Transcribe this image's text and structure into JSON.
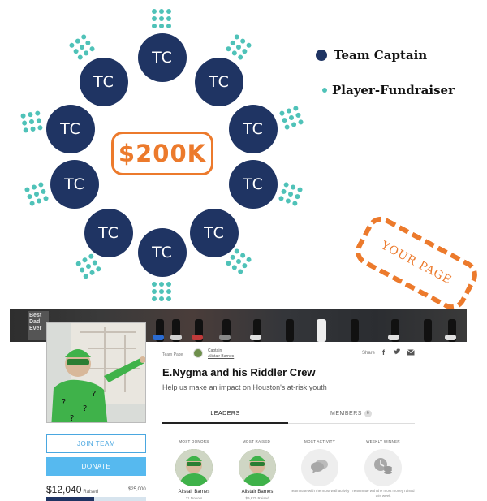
{
  "infographic": {
    "circle_label": "TC",
    "goal_label": "$200K",
    "legend": {
      "captain": "Team Captain",
      "fundraiser": "Player-Fundraiser"
    },
    "callout": "YOUR PAGE",
    "colors": {
      "captain": "#1f3463",
      "fundraiser": "#4fc2b8",
      "accent": "#ec7a2c"
    }
  },
  "team_page": {
    "meta_label": "Team Page",
    "captain_label": "Captain",
    "captain_name": "Alistair Barnes",
    "share_label": "Share",
    "title": "E.Nygma and his Riddler Crew",
    "subtitle": "Help us make an impact on Houston's at-risk youth",
    "tabs": [
      {
        "label": "LEADERS",
        "active": true
      },
      {
        "label": "MEMBERS",
        "count": "6",
        "active": false
      }
    ],
    "join_label": "JOIN TEAM",
    "donate_label": "DONATE",
    "raised_amount": "$12,040",
    "raised_label": "Raised",
    "goal_amount": "$25,000",
    "progress_fraction": 0.48,
    "stats": [
      {
        "heading": "MOST DONORS",
        "name": "Alistair Barnes",
        "detail": "11 Donors"
      },
      {
        "heading": "MOST RAISED",
        "name": "Alistair Barnes",
        "detail": "$9,670 Raised"
      },
      {
        "heading": "MOST ACTIVITY",
        "note": "Teammate with the most wall activity"
      },
      {
        "heading": "WEEKLY WINNER",
        "note": "Teammate with the most money raised this week"
      }
    ],
    "banner_text": "Best Dad Ever",
    "accent_color": "#56b9ef"
  }
}
